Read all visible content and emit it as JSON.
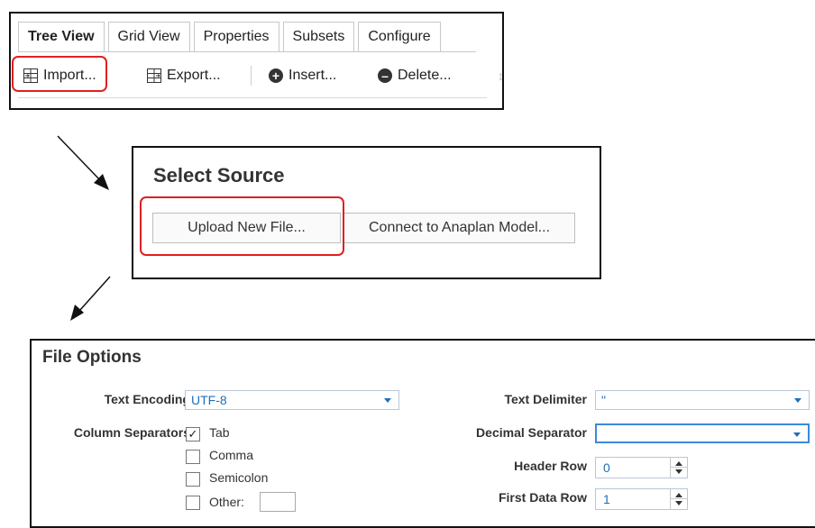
{
  "tabs": [
    "Tree View",
    "Grid View",
    "Properties",
    "Subsets",
    "Configure"
  ],
  "toolbar": {
    "import_label": "Import...",
    "export_label": "Export...",
    "insert_label": "Insert...",
    "delete_label": "Delete..."
  },
  "select_source": {
    "title": "Select Source",
    "upload_label": "Upload New File...",
    "connect_label": "Connect to Anaplan Model..."
  },
  "file_options": {
    "title": "File Options",
    "text_encoding_label": "Text Encoding",
    "text_encoding_value": "UTF-8",
    "column_separators_label": "Column Separators",
    "separators": [
      {
        "label": "Tab",
        "checked": true
      },
      {
        "label": "Comma",
        "checked": false
      },
      {
        "label": "Semicolon",
        "checked": false
      },
      {
        "label": "Other:",
        "checked": false
      }
    ],
    "text_delimiter_label": "Text Delimiter",
    "text_delimiter_value": "\"",
    "decimal_separator_label": "Decimal Separator",
    "decimal_separator_value": "",
    "header_row_label": "Header Row",
    "header_row_value": "0",
    "first_data_row_label": "First Data Row",
    "first_data_row_value": "1"
  },
  "colors": {
    "highlight": "#e02020",
    "accent": "#1f6fb5",
    "border": "#111111"
  }
}
